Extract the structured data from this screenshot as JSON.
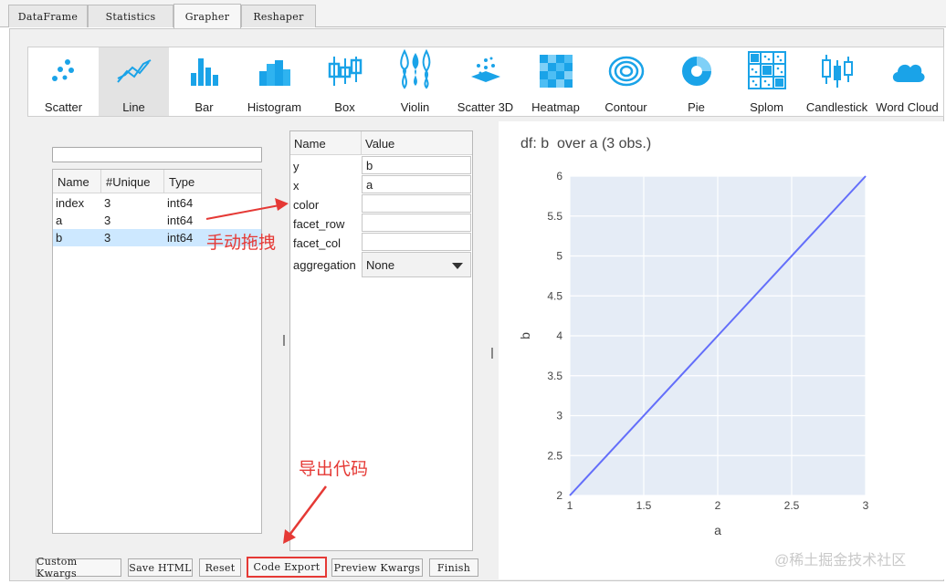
{
  "tabs": [
    "DataFrame",
    "Statistics",
    "Grapher",
    "Reshaper"
  ],
  "active_tab": "Grapher",
  "chart_types": [
    {
      "label": "Scatter",
      "icon": "scatter-icon"
    },
    {
      "label": "Line",
      "icon": "line-chart-icon"
    },
    {
      "label": "Bar",
      "icon": "bar-chart-icon"
    },
    {
      "label": "Histogram",
      "icon": "histogram-icon"
    },
    {
      "label": "Box",
      "icon": "box-plot-icon"
    },
    {
      "label": "Violin",
      "icon": "violin-icon"
    },
    {
      "label": "Scatter 3D",
      "icon": "scatter-3d-icon"
    },
    {
      "label": "Heatmap",
      "icon": "heatmap-icon"
    },
    {
      "label": "Contour",
      "icon": "contour-icon"
    },
    {
      "label": "Pie",
      "icon": "pie-icon"
    },
    {
      "label": "Splom",
      "icon": "splom-icon"
    },
    {
      "label": "Candlestick",
      "icon": "candlestick-icon"
    },
    {
      "label": "Word Cloud",
      "icon": "word-cloud-icon"
    }
  ],
  "active_chart": "Line",
  "columns": {
    "search_value": "",
    "headers": [
      "Name",
      "#Unique",
      "Type"
    ],
    "rows": [
      {
        "name": "index",
        "unique": "3",
        "type": "int64",
        "selected": false
      },
      {
        "name": "a",
        "unique": "3",
        "type": "int64",
        "selected": false
      },
      {
        "name": "b",
        "unique": "3",
        "type": "int64",
        "selected": true
      }
    ]
  },
  "properties": {
    "headers": [
      "Name",
      "Value"
    ],
    "fields": [
      {
        "name": "y",
        "value": "b"
      },
      {
        "name": "x",
        "value": "a"
      },
      {
        "name": "color",
        "value": ""
      },
      {
        "name": "facet_row",
        "value": ""
      },
      {
        "name": "facet_col",
        "value": ""
      }
    ],
    "aggregation": {
      "name": "aggregation",
      "value": "None"
    }
  },
  "plot_title": "df: b  over a (3 obs.)",
  "chart_data": {
    "type": "line",
    "title": "df: b  over a (3 obs.)",
    "xlabel": "a",
    "ylabel": "b",
    "x": [
      1,
      2,
      3
    ],
    "series": [
      {
        "values": [
          2,
          4,
          6
        ],
        "color": "#636efa"
      }
    ],
    "xlim": [
      1,
      3
    ],
    "ylim": [
      2,
      6
    ],
    "xticks": [
      "1",
      "1.5",
      "2",
      "2.5",
      "3"
    ],
    "yticks": [
      "2",
      "2.5",
      "3",
      "3.5",
      "4",
      "4.5",
      "5",
      "5.5",
      "6"
    ],
    "grid": true,
    "background": "#e5ecf6"
  },
  "buttons": [
    "Custom Kwargs",
    "Save HTML",
    "Reset",
    "Code Export",
    "Preview Kwargs",
    "Finish"
  ],
  "annotations": {
    "drag": "手动拖拽",
    "export": "导出代码"
  },
  "watermark": "@稀土掘金技术社区",
  "colors": {
    "accent": "#1aa3e8",
    "annotation": "#e53935",
    "selection": "#cde8ff",
    "plot_line": "#636efa"
  }
}
